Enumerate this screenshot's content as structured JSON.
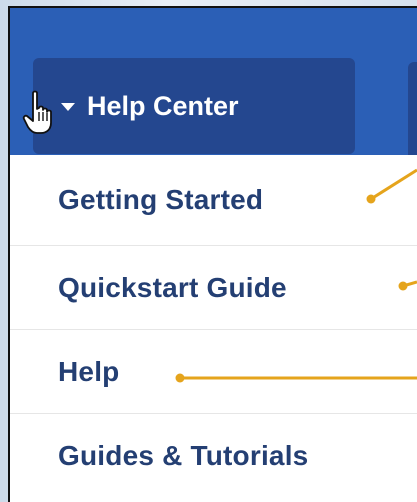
{
  "navbar": {
    "menu_button_label": "Help Center",
    "dropdown_icon": "caret-down-icon"
  },
  "menu": {
    "items": [
      {
        "label": "Getting Started"
      },
      {
        "label": "Quickstart Guide"
      },
      {
        "label": "Help"
      },
      {
        "label": "Guides & Tutorials"
      }
    ]
  },
  "colors": {
    "navbar_bg": "#2b5fb6",
    "button_bg": "#24478f",
    "menu_text": "#243f73",
    "callout": "#e5a41c"
  },
  "cursor": "hand-pointer-icon"
}
